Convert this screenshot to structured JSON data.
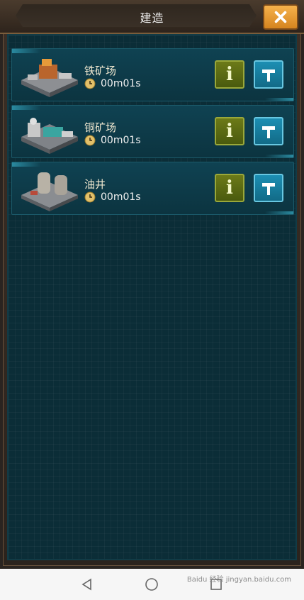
{
  "header": {
    "title": "建造",
    "close_icon": "close-icon"
  },
  "buildings": [
    {
      "name": "铁矿场",
      "time": "00m01s",
      "image_icon": "iron-mine-icon"
    },
    {
      "name": "铜矿场",
      "time": "00m01s",
      "image_icon": "copper-mine-icon"
    },
    {
      "name": "油井",
      "time": "00m01s",
      "image_icon": "oil-well-icon"
    }
  ],
  "buttons": {
    "info_label": "i",
    "build_icon": "hammer-icon"
  },
  "system_nav": {
    "back_icon": "back-triangle-icon",
    "home_icon": "home-circle-icon",
    "recents_icon": "recents-square-icon"
  },
  "watermark": "Baidu 经验 jingyan.baidu.com",
  "colors": {
    "panel": "#0b2d37",
    "info": "#4a5a0e",
    "build": "#126b87",
    "close": "#f6b24c"
  }
}
